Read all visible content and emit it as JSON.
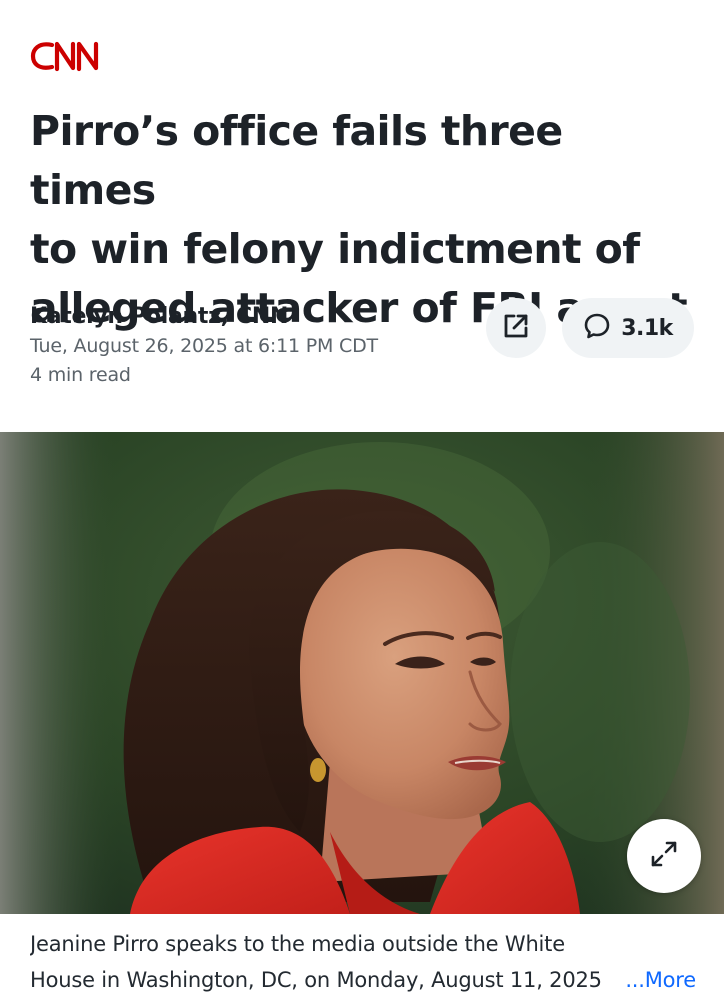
{
  "brand": {
    "name": "CNN",
    "color": "#cc0000"
  },
  "article": {
    "headline_lines": [
      "Pirro’s office fails three times",
      "to win felony indictment of",
      "alleged attacker of FBI agent"
    ],
    "author": "Katelyn Polantz, CNN",
    "date": "Tue, August 26, 2025 at 6:11 PM CDT",
    "read_time": "4 min read"
  },
  "actions": {
    "share_icon": "share-icon",
    "comment_icon": "comment-icon",
    "comment_count": "3.1k",
    "expand_icon": "expand-icon"
  },
  "image": {
    "description_icon": "photo",
    "caption_line1": "Jeanine Pirro speaks to the media outside the White",
    "caption_line2": "House in Washington, DC, on Monday, August 11, 2025",
    "more_label": "...More"
  },
  "colors": {
    "text": "#1d2228",
    "meta": "#5b636a",
    "link": "#0f69ff",
    "pill": "#f0f3f5"
  }
}
